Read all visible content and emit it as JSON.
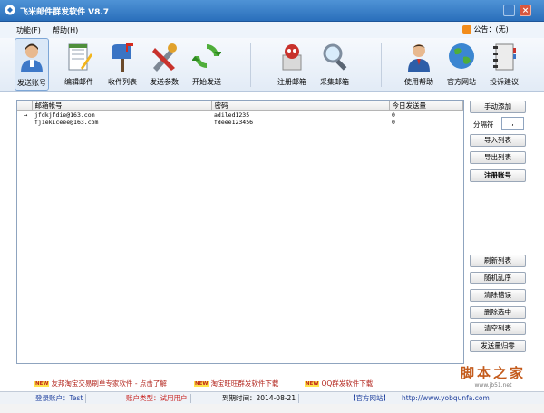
{
  "window": {
    "title": "飞米邮件群发软件  V8.7"
  },
  "menu": {
    "items": [
      "功能(F)",
      "帮助(H)"
    ],
    "notice": "公告：(无)"
  },
  "toolbar": {
    "buttons": [
      {
        "label": "发送账号",
        "icon": "user-account-icon"
      },
      {
        "label": "编辑邮件",
        "icon": "edit-mail-icon"
      },
      {
        "label": "收件列表",
        "icon": "mailbox-icon"
      },
      {
        "label": "发送参数",
        "icon": "tools-icon"
      },
      {
        "label": "开始发送",
        "icon": "refresh-send-icon"
      },
      {
        "label": "注册邮箱",
        "icon": "register-mail-icon"
      },
      {
        "label": "采集邮箱",
        "icon": "search-magnifier-icon"
      },
      {
        "label": "使用帮助",
        "icon": "help-person-icon"
      },
      {
        "label": "官方网站",
        "icon": "globe-icon"
      },
      {
        "label": "投诉建议",
        "icon": "notebook-icon"
      }
    ],
    "active_index": 0
  },
  "grid": {
    "columns": [
      "",
      "邮箱帐号",
      "密码",
      "今日发送量"
    ],
    "rows": [
      {
        "indicator": "→",
        "account": "jfdkjfdie@163.com",
        "password": "adiled1235",
        "sent": "0"
      },
      {
        "indicator": "",
        "account": "fjiekiceee@163.com",
        "password": "fdeee123456",
        "sent": "0"
      }
    ]
  },
  "side_panel": {
    "add_manual": "手动添加",
    "separator_label": "分隔符",
    "separator_value": ",",
    "import_list": "导入列表",
    "export_list": "导出列表",
    "register_account": "注册账号",
    "refresh_list": "刷新列表",
    "random_order": "随机乱序",
    "clear_errors": "清除错误",
    "delete_selected": "删除选中",
    "clear_list": "清空列表",
    "reset_sent": "发送量归零"
  },
  "ads": {
    "badge": "NEW",
    "items": [
      "友邦淘宝交易刷单专家软件 - 点击了解",
      "淘宝旺旺群发软件下载",
      "QQ群发软件下载"
    ]
  },
  "watermark": {
    "title": "脚本之家",
    "url": "www.jb51.net"
  },
  "status": {
    "login_account": "登录账户：Test",
    "account_type": "账户类型：试用用户",
    "expire": "到期时间：2014-08-21",
    "official_site": "【官方网站】",
    "url": "http://www.yobqunfa.com"
  }
}
